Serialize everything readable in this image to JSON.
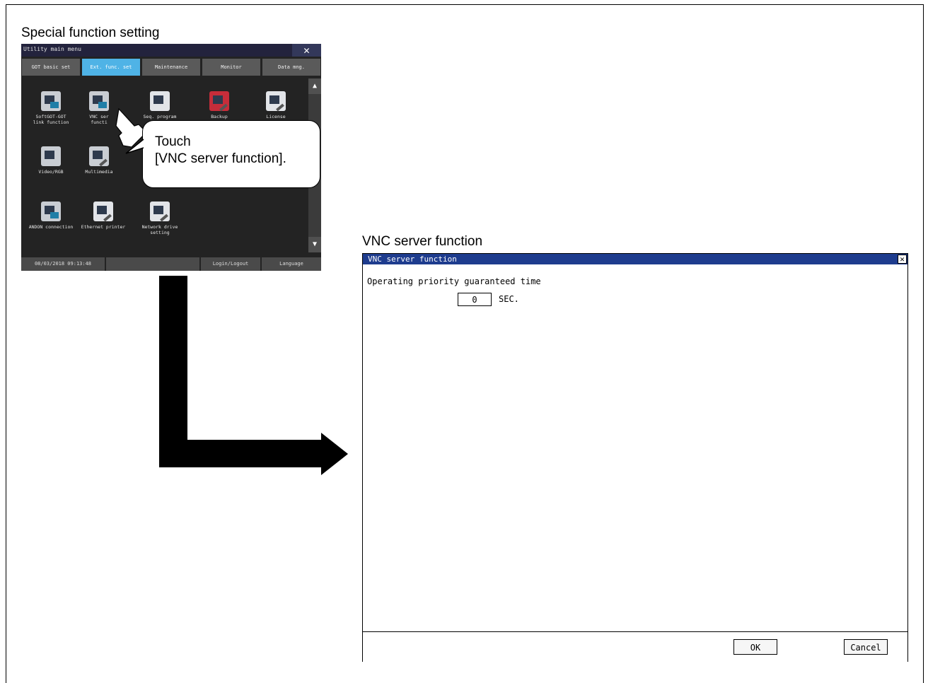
{
  "left_section": {
    "title": "Special function setting",
    "callout_line1": "Touch",
    "callout_line2": "[VNC server function]."
  },
  "utility_menu": {
    "title": "Utility main menu",
    "close": "✕",
    "tabs": [
      "GOT basic set",
      "Ext. func. set",
      "Maintenance",
      "Monitor",
      "Data mng."
    ],
    "active_tab": 1,
    "items": [
      {
        "label1": "SoftGOT-GOT",
        "label2": "link function"
      },
      {
        "label1": "VNC ser",
        "label2": "functi"
      },
      {
        "label1": "Seq. program",
        "label2": ""
      },
      {
        "label1": "Backup",
        "label2": ""
      },
      {
        "label1": "License",
        "label2": ""
      },
      {
        "label1": "Video/RGB",
        "label2": ""
      },
      {
        "label1": "Multimedia",
        "label2": ""
      },
      {
        "label1": "ANDON connection",
        "label2": ""
      },
      {
        "label1": "Ethernet printer",
        "label2": ""
      },
      {
        "label1": "Network drive",
        "label2": "setting"
      }
    ],
    "status": {
      "datetime": "08/03/2018 09:13:48",
      "login": "Login/Logout",
      "language": "Language"
    }
  },
  "right_section": {
    "title": "VNC server function"
  },
  "vnc_dialog": {
    "title": "VNC server function",
    "close": "✕",
    "field_label": "Operating priority guaranteed time",
    "field_value": "0",
    "field_unit": "SEC.",
    "ok": "OK",
    "cancel": "Cancel"
  }
}
